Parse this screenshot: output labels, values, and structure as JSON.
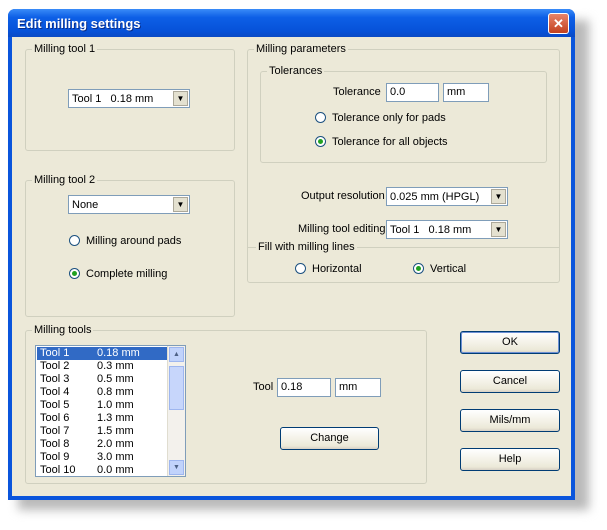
{
  "window": {
    "title": "Edit milling settings",
    "close_glyph": "✕"
  },
  "milling_tool_1": {
    "legend": "Milling tool 1",
    "selected": "Tool 1   0.18 mm"
  },
  "milling_tool_2": {
    "legend": "Milling tool 2",
    "selected": "None",
    "option_around": "Milling around pads",
    "option_complete": "Complete milling",
    "checked": "Complete milling"
  },
  "milling_parameters": {
    "legend": "Milling parameters",
    "tolerances": {
      "legend": "Tolerances",
      "tolerance_label": "Tolerance",
      "tolerance_value": "0.0",
      "unit": "mm",
      "option_pads": "Tolerance only for pads",
      "option_all": "Tolerance for all objects",
      "checked": "Tolerance for all objects"
    },
    "output_resolution_label": "Output resolution",
    "output_resolution_value": "0.025 mm (HPGL)",
    "milling_tool_editing_label": "Milling tool editing",
    "milling_tool_editing_value": "Tool 1   0.18 mm",
    "fill": {
      "legend": "Fill with milling lines",
      "horizontal": "Horizontal",
      "vertical": "Vertical",
      "checked": "Vertical"
    }
  },
  "milling_tools": {
    "legend": "Milling tools",
    "items": [
      {
        "name": "Tool 1",
        "size": "0.18 mm",
        "selected": true
      },
      {
        "name": "Tool 2",
        "size": "0.3 mm"
      },
      {
        "name": "Tool 3",
        "size": "0.5 mm"
      },
      {
        "name": "Tool 4",
        "size": "0.8 mm"
      },
      {
        "name": "Tool 5",
        "size": "1.0 mm"
      },
      {
        "name": "Tool 6",
        "size": "1.3 mm"
      },
      {
        "name": "Tool 7",
        "size": "1.5 mm"
      },
      {
        "name": "Tool 8",
        "size": "2.0 mm"
      },
      {
        "name": "Tool 9",
        "size": "3.0 mm"
      },
      {
        "name": "Tool 10",
        "size": "0.0 mm"
      }
    ],
    "tool_label": "Tool",
    "tool_value": "0.18",
    "tool_unit": "mm",
    "change_label": "Change"
  },
  "buttons": {
    "ok": "OK",
    "cancel": "Cancel",
    "units": "Mils/mm",
    "help": "Help"
  },
  "colors": {
    "titlebar": "#0651d8",
    "face": "#ece9d8",
    "selection": "#316ac5"
  }
}
